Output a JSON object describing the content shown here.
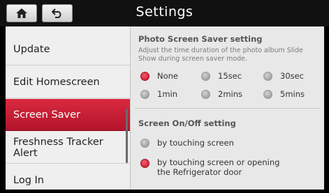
{
  "header": {
    "title": "Settings",
    "home_icon": "home-icon",
    "back_icon": "back-arrow-icon"
  },
  "sidebar": {
    "items": [
      {
        "label": "Update",
        "active": false
      },
      {
        "label": "Edit Homescreen",
        "active": false
      },
      {
        "label": "Screen Saver",
        "active": true
      },
      {
        "label": "Freshness Tracker Alert",
        "active": false
      },
      {
        "label": "Log In",
        "active": false
      }
    ]
  },
  "photo_saver": {
    "title": "Photo Screen Saver setting",
    "description": "Adjust the time duration of the photo album Slide Show during screen saver mode.",
    "options": [
      "None",
      "15sec",
      "30sec",
      "1min",
      "2mins",
      "5mins"
    ],
    "selected": "None"
  },
  "screen_onoff": {
    "title": "Screen On/Off setting",
    "options": [
      "by touching screen",
      "by touching screen or opening the Refrigerator door"
    ],
    "selected": "by touching screen or opening the Refrigerator door"
  },
  "colors": {
    "accent": "#c8192f",
    "header": "#111111",
    "panel": "#e8e8e8"
  }
}
